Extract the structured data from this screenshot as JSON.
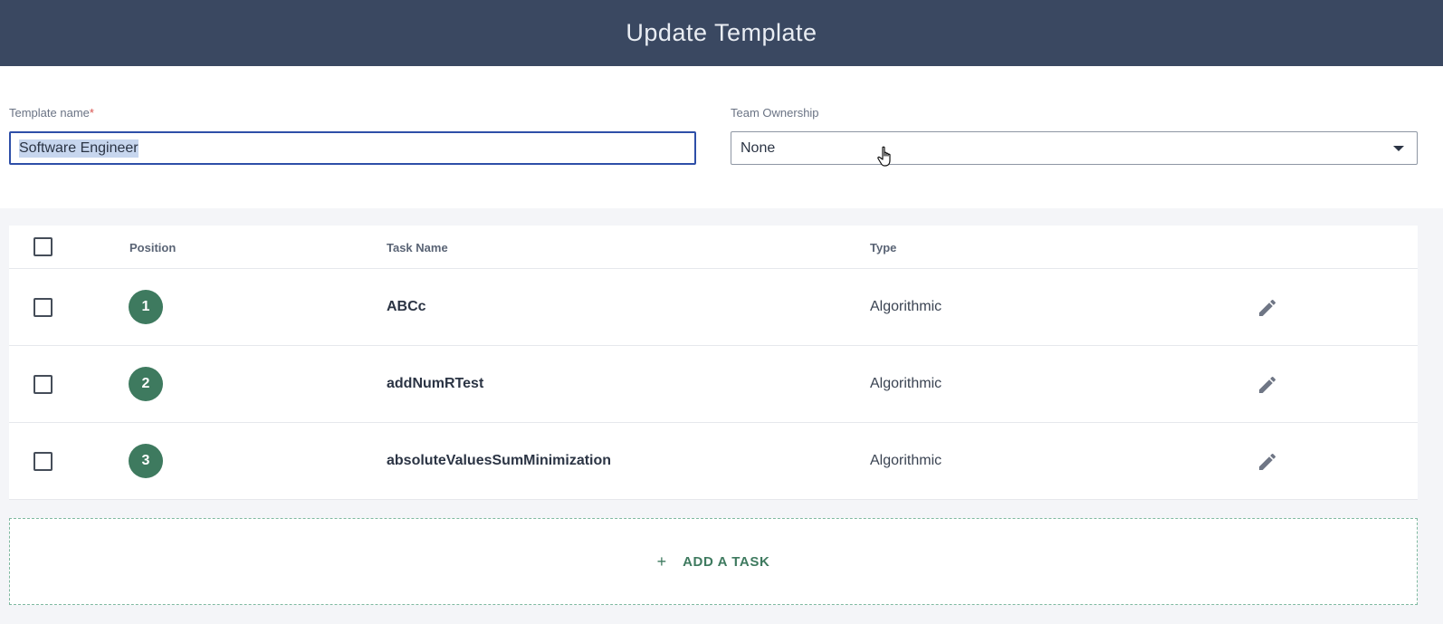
{
  "header": {
    "title": "Update Template"
  },
  "form": {
    "template_name_label": "Template name",
    "required_mark": "*",
    "template_name_value": "Software Engineer",
    "team_ownership_label": "Team Ownership",
    "team_ownership_value": "None"
  },
  "table": {
    "columns": {
      "position": "Position",
      "task_name": "Task Name",
      "type": "Type"
    },
    "rows": [
      {
        "position": "1",
        "task_name": "ABCc",
        "type": "Algorithmic"
      },
      {
        "position": "2",
        "task_name": "addNumRTest",
        "type": "Algorithmic"
      },
      {
        "position": "3",
        "task_name": "absoluteValuesSumMinimization",
        "type": "Algorithmic"
      }
    ]
  },
  "add_task": {
    "plus": "+",
    "label": "ADD A TASK"
  },
  "icons": {
    "edit": "pencil-icon",
    "dropdown": "caret-down-icon",
    "cursor": "hand-pointer-icon"
  },
  "colors": {
    "header_bg": "#3a4861",
    "accent_green": "#3e7a5f",
    "focus_blue": "#2e4fa8"
  }
}
